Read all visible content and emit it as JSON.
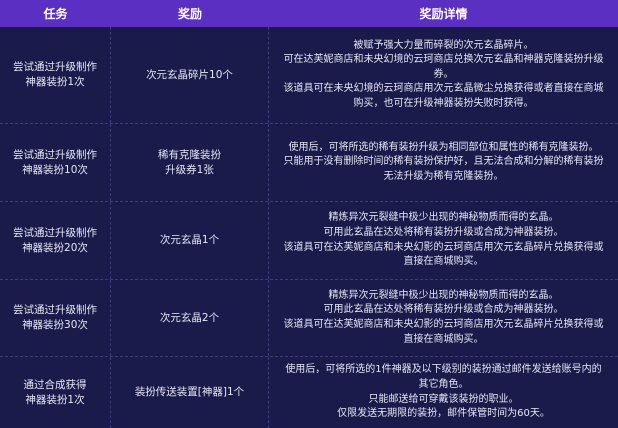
{
  "header": {
    "task": "任务",
    "reward": "奖励",
    "detail": "奖励详情"
  },
  "rows": [
    {
      "task": "尝试通过升级制作\n神器装扮1次",
      "reward": "次元玄晶碎片10个",
      "detail": "被赋予强大力量而碎裂的次元玄晶碎片。\n可在达芙妮商店和未央幻境的云珂商店兑换次元玄晶和神器克隆装扮升级券。\n该道具可在未央幻境的云珂商店用次元玄晶微尘兑换获得或者直接在商城购买，也可在升级神器装扮失败时获得。"
    },
    {
      "task": "尝试通过升级制作\n神器装扮10次",
      "reward": "稀有克隆装扮\n升级券1张",
      "detail": "使用后，可将所选的稀有装扮升级为相同部位和属性的稀有克隆装扮。\n只能用于没有删除时间的稀有装扮保护好，且无法合成和分解的稀有装扮无法升级为稀有克隆装扮。"
    },
    {
      "task": "尝试通过升级制作\n神器装扮20次",
      "reward": "次元玄晶1个",
      "detail": "精炼异次元裂缝中极少出现的神秘物质而得的玄晶。\n可用此玄晶在达处将稀有装扮升级或合成为神器装扮。\n该道具可在达芙妮商店和未央幻影的云珂商店用次元玄晶碎片兑换获得或直接在商城购买。"
    },
    {
      "task": "尝试通过升级制作\n神器装扮30次",
      "reward": "次元玄晶2个",
      "detail": "精炼异次元裂缝中极少出现的神秘物质而得的玄晶。\n可用此玄晶在达处将稀有装扮升级或合成为神器装扮。\n该道具可在达芙妮商店和未央幻影的云珂商店用次元玄晶碎片兑换获得或直接在商城购买。"
    },
    {
      "task": "通过合成获得\n神器装扮1次",
      "reward": "装扮传送装置[神器]1个",
      "detail": "使用后，可将所选的1件神器及以下级别的装扮通过邮件发送给账号内的其它角色。\n只能邮送给可穿戴该装扮的职业。\n仅限发送无期限的装扮，邮件保管时间为60天。"
    }
  ]
}
